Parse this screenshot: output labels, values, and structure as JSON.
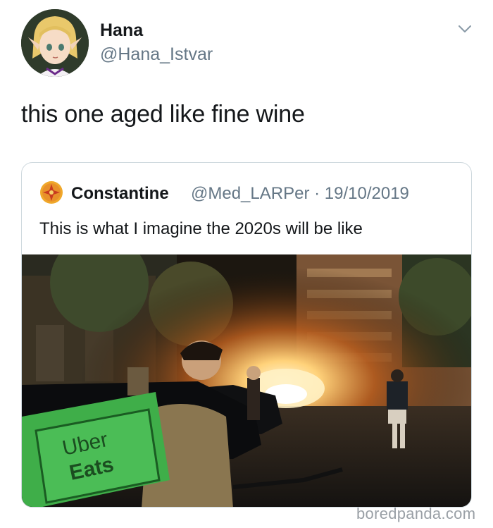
{
  "tweet": {
    "author_name": "Hana",
    "author_handle": "@Hana_Istvar",
    "text": "this one aged like fine wine"
  },
  "quoted_tweet": {
    "author_name": "Constantine",
    "author_handle": "@Med_LARPer",
    "separator": "·",
    "date": "19/10/2019",
    "text": "This is what I imagine the 2020s will be like",
    "image": {
      "bag_text_line1": "Uber",
      "bag_text_line2": "Eats"
    }
  },
  "icons": {
    "menu": "chevron-down-icon",
    "quoted_avatar": "crest-icon"
  },
  "colors": {
    "primary_text": "#14171a",
    "secondary_text": "#657786",
    "border": "#cfd9de",
    "bag_green": "#3fae49"
  },
  "watermark": "boredpanda.com"
}
